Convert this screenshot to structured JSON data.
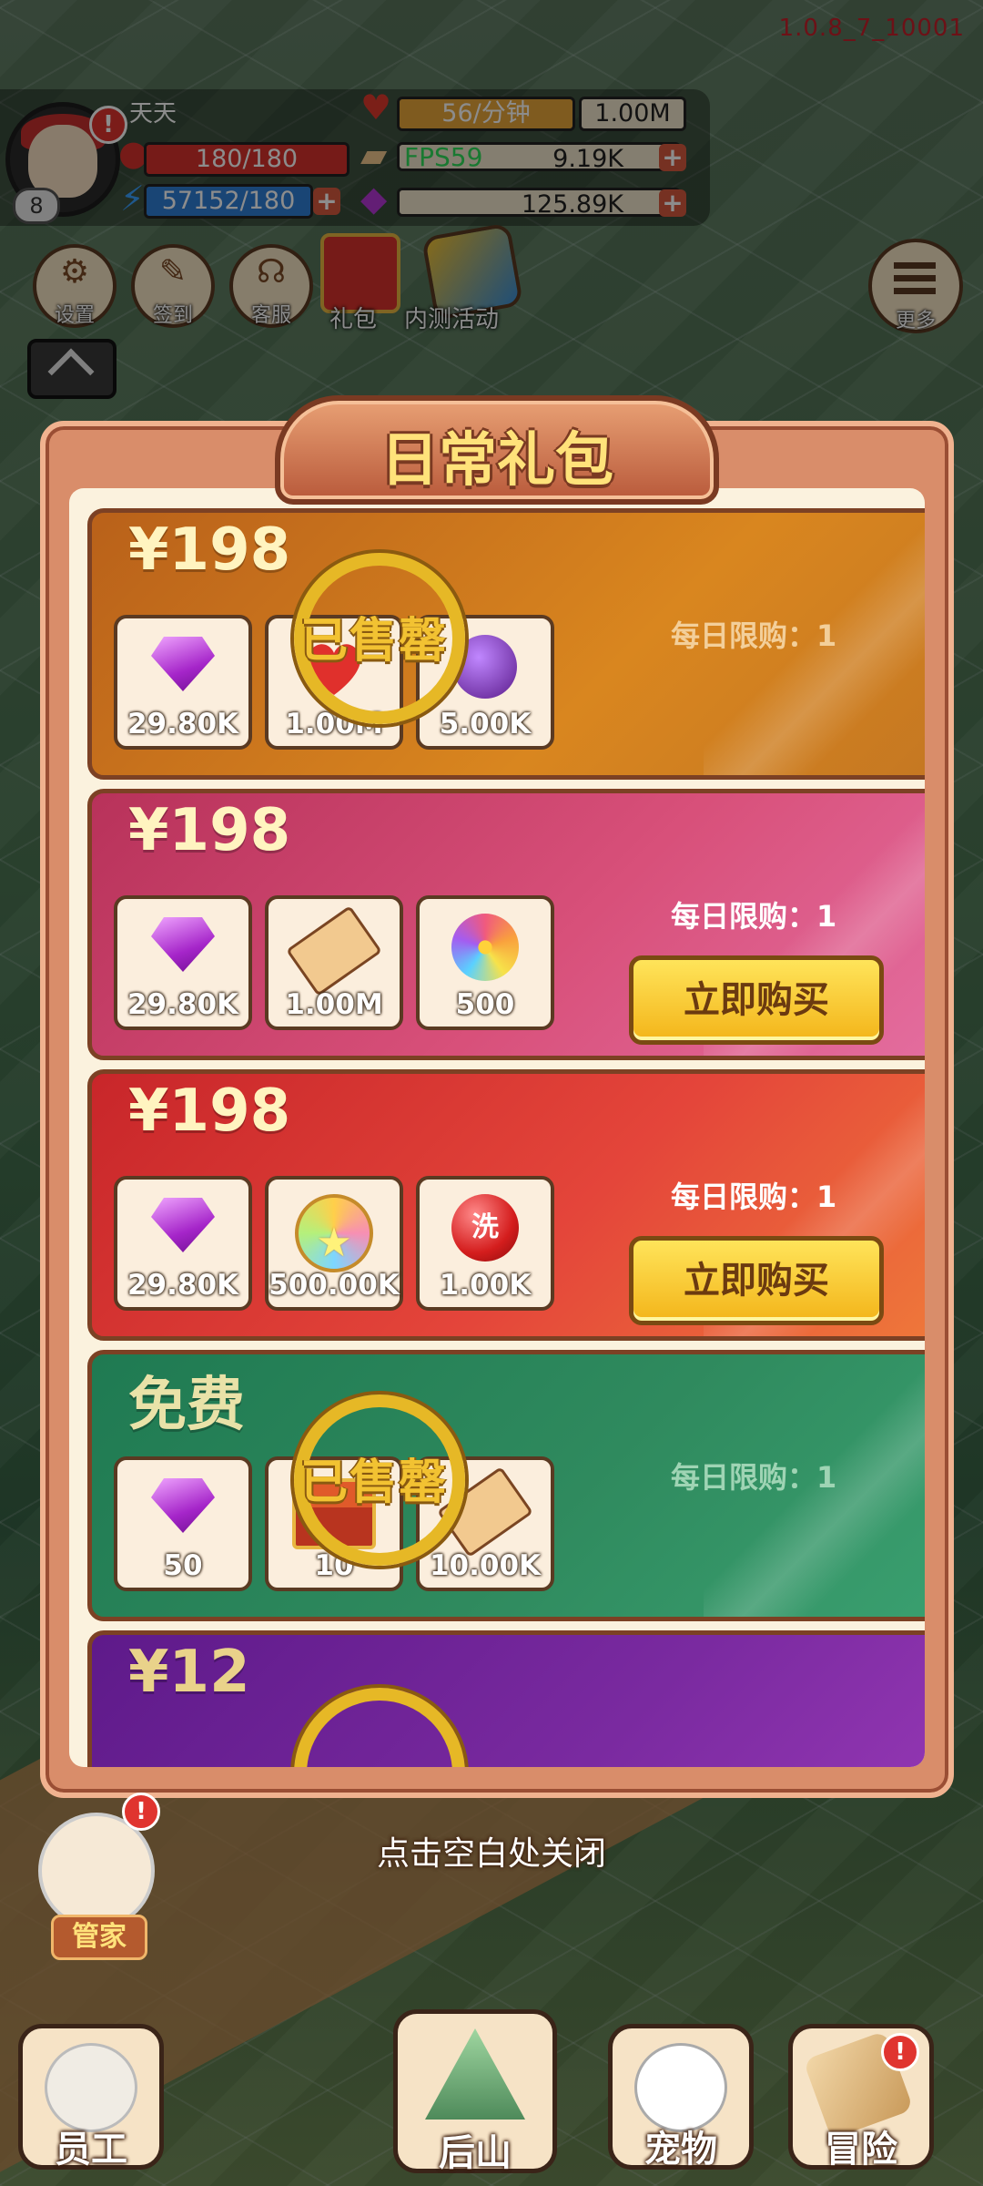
{
  "version": "1.0.8_7_10001",
  "player": {
    "name": "天天",
    "level": "8",
    "hp": "180/180",
    "energy": "57152/180"
  },
  "resources": {
    "hearts_rate": "56/分钟",
    "hearts_total": "1.00M",
    "fps": "FPS59",
    "tickets": "9.19K",
    "gems": "125.89K"
  },
  "top_menu": {
    "settings": "设置",
    "checkin": "签到",
    "service": "客服",
    "gift": "礼包",
    "beta_event": "内测活动",
    "more": "更多"
  },
  "dialog": {
    "title": "日常礼包",
    "limit_label": "每日限购：1",
    "buy_label": "立即购买",
    "soldout_label": "已售罄",
    "close_hint": "点击空白处关闭",
    "packs": [
      {
        "price": "¥198",
        "status": "soldout",
        "items": [
          {
            "icon": "gem-icon",
            "qty": "29.80K"
          },
          {
            "icon": "heart-icon",
            "qty": "1.00M"
          },
          {
            "icon": "orb-icon",
            "qty": "5.00K"
          }
        ]
      },
      {
        "price": "¥198",
        "status": "available",
        "items": [
          {
            "icon": "gem-icon",
            "qty": "29.80K"
          },
          {
            "icon": "ticket-icon",
            "qty": "1.00M"
          },
          {
            "icon": "flower-icon",
            "qty": "500"
          }
        ]
      },
      {
        "price": "¥198",
        "status": "available",
        "items": [
          {
            "icon": "gem-icon",
            "qty": "29.80K"
          },
          {
            "icon": "medal-icon",
            "qty": "500.00K"
          },
          {
            "icon": "wash-ball-icon",
            "qty": "1.00K",
            "label": "洗"
          }
        ]
      },
      {
        "price": "免费",
        "status": "soldout",
        "items": [
          {
            "icon": "gem-icon",
            "qty": "50"
          },
          {
            "icon": "chest-icon",
            "qty": "10"
          },
          {
            "icon": "ticket-icon",
            "qty": "10.00K"
          }
        ]
      },
      {
        "price": "¥12",
        "status": "soldout",
        "items": []
      }
    ]
  },
  "butler_label": "管家",
  "bottom_nav": {
    "staff": "员工",
    "mountain": "后山",
    "pet": "宠物",
    "adventure": "冒险"
  },
  "colors": {
    "pack_orange": "#c8731e",
    "pack_pink": "#d84f74",
    "pack_red": "#e5493a",
    "pack_green": "#2f8a5e",
    "pack_purple": "#7a2aa0",
    "buy_button": "#f6c52a"
  }
}
